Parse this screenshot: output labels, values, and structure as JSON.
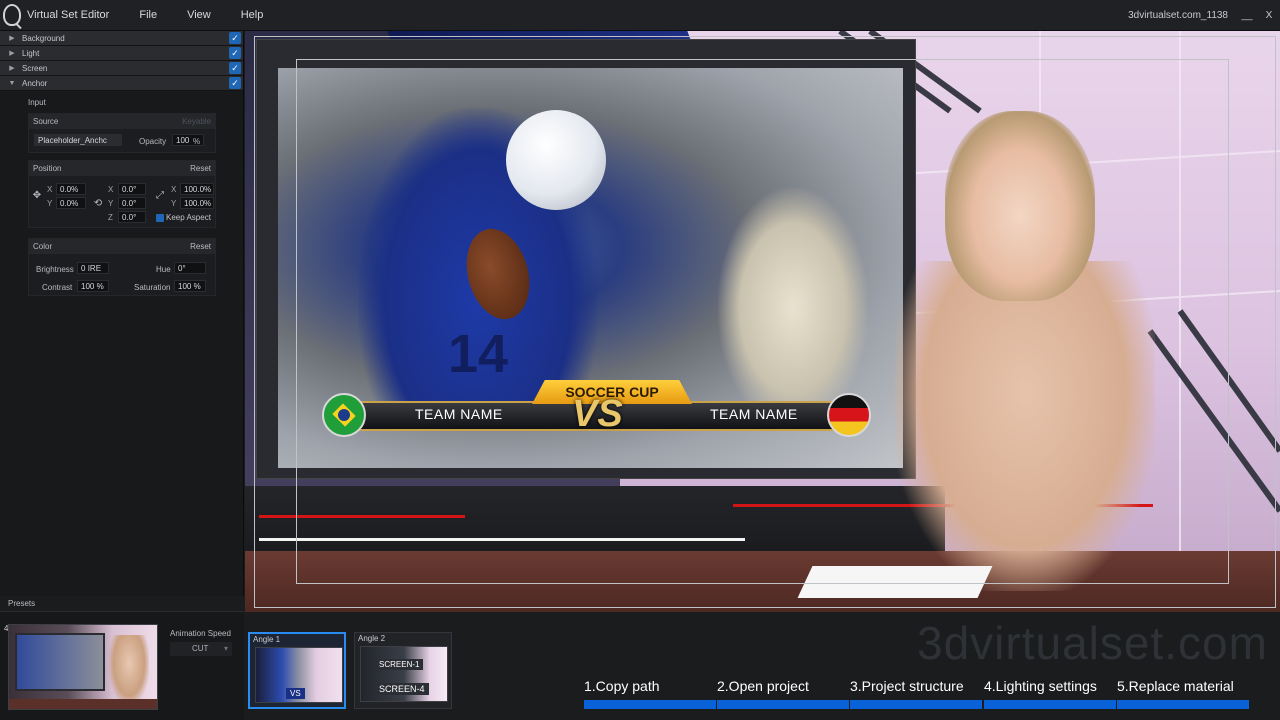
{
  "titlebar": {
    "app_title": "Virtual Set Editor",
    "menus": [
      "File",
      "View",
      "Help"
    ],
    "project": "3dvirtualset.com_1138",
    "minimize": "__",
    "close": "X"
  },
  "sidebar": {
    "sections": [
      {
        "label": "Background",
        "expanded": false,
        "checked": true
      },
      {
        "label": "Light",
        "expanded": false,
        "checked": true
      },
      {
        "label": "Screen",
        "expanded": false,
        "checked": true
      },
      {
        "label": "Anchor",
        "expanded": true,
        "checked": true
      }
    ],
    "input_label": "Input",
    "source": {
      "title": "Source",
      "keyable": "Keyable",
      "placeholder_value": "Placeholder_Anchc",
      "opacity_label": "Opacity",
      "opacity_value": "100",
      "opacity_unit": "%"
    },
    "position": {
      "title": "Position",
      "reset": "Reset",
      "x_label": "X",
      "y_label": "Y",
      "z_label": "Z",
      "move_x": "0.0%",
      "move_y": "0.0%",
      "rot_x": "0.0°",
      "rot_y": "0.0°",
      "rot_z": "0.0°",
      "scale_x": "100.0%",
      "scale_y": "100.0%",
      "keep_aspect": "Keep Aspect"
    },
    "color": {
      "title": "Color",
      "reset": "Reset",
      "brightness_label": "Brightness",
      "brightness_value": "0",
      "brightness_unit": "IRE",
      "hue_label": "Hue",
      "hue_value": "0°",
      "contrast_label": "Contrast",
      "contrast_value": "100",
      "contrast_unit": "%",
      "saturation_label": "Saturation",
      "saturation_value": "100",
      "saturation_unit": "%"
    }
  },
  "presets": {
    "label": "Presets",
    "index": "4",
    "animation_speed_label": "Animation Speed",
    "animation_speed_value": "CUT"
  },
  "viewport": {
    "lower_third": {
      "title": "SOCCER CUP",
      "team_left": "TEAM NAME",
      "vs": "VS",
      "team_right": "TEAM NAME"
    },
    "jersey_number": "14"
  },
  "watermark": "3dvirtualset.com",
  "angles": [
    {
      "label": "Angle 1",
      "active": true,
      "screen_text": "VS"
    },
    {
      "label": "Angle 2",
      "active": false,
      "screen_text_top": "SCREEN-1",
      "screen_text_bottom": "SCREEN-4"
    }
  ],
  "steps": [
    "1.Copy path",
    "2.Open project",
    "3.Project structure",
    "4.Lighting settings",
    "5.Replace material"
  ],
  "colors": {
    "accent": "#0a62d8",
    "selected_border": "#2a8cf0",
    "check": "#1f67b5"
  }
}
